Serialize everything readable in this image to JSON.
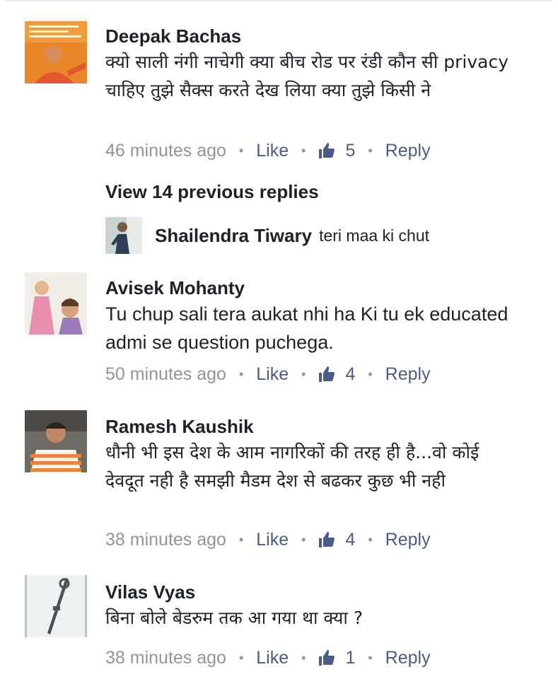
{
  "comments": [
    {
      "author": "Deepak Bachas",
      "text": "क्यो साली नंगी नाचेगी क्या बीच रोड पर रंडी कौन सी privacy  चाहिए तुझे सैक्स करते देख लिया क्या तुझे किसी ने",
      "time": "46 minutes ago",
      "like_label": "Like",
      "like_count": "5",
      "reply_label": "Reply"
    },
    {
      "author": "Avisek Mohanty",
      "text": "Tu chup sali tera aukat nhi ha Ki tu ek educated admi se question puchega.",
      "time": "50 minutes ago",
      "like_label": "Like",
      "like_count": "4",
      "reply_label": "Reply"
    },
    {
      "author": "Ramesh Kaushik",
      "text": "धौनी भी इस देश के आम नागरिकों की तरह ही है...वो कोई देवदूत नही है समझी मैडम देश से बढकर कुछ भी नही",
      "time": "38 minutes ago",
      "like_label": "Like",
      "like_count": "4",
      "reply_label": "Reply"
    },
    {
      "author": "Vilas Vyas",
      "text": "बिना बोले बेडरुम तक आ गया था क्या ?",
      "time": "38 minutes ago",
      "like_label": "Like",
      "like_count": "1",
      "reply_label": "Reply"
    }
  ],
  "replies_thread": {
    "view_previous": "View 14 previous replies",
    "reply": {
      "author": "Shailendra Tiwary",
      "text": "teri maa ki chut"
    }
  },
  "colors": {
    "author": "#1d2129",
    "meta": "#90949c",
    "action": "#4b5c86"
  },
  "icons": [
    "thumbs-up-icon"
  ]
}
